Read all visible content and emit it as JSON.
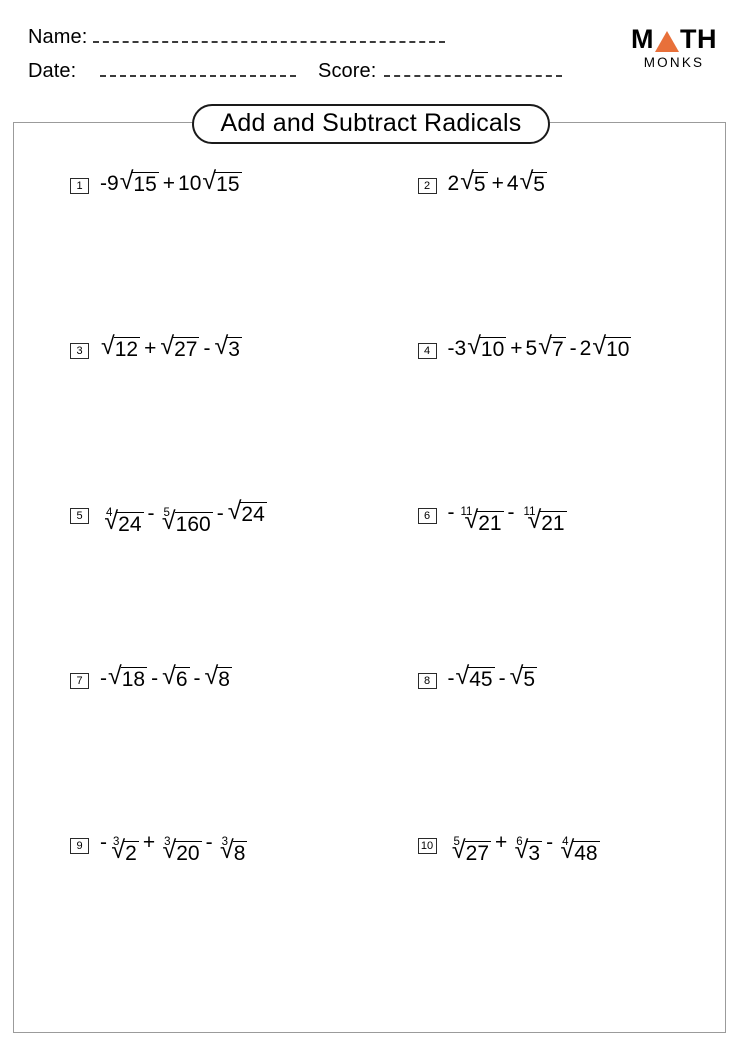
{
  "header": {
    "name_label": "Name:",
    "date_label": "Date:",
    "score_label": "Score:"
  },
  "logo": {
    "word_m": "M",
    "triangle_icon": "triangle-icon",
    "word_th": "TH",
    "subtitle": "MONKS",
    "accent_color": "#e8703a"
  },
  "worksheet": {
    "title": "Add and Subtract Radicals",
    "border_color": "#9b9b9b"
  },
  "problems": [
    {
      "number": "1",
      "expression": "-9√15 + 10√15",
      "terms": [
        {
          "coef": "-9",
          "index": "",
          "radicand": "15"
        },
        {
          "op": "+",
          "coef": "10",
          "index": "",
          "radicand": "15"
        }
      ]
    },
    {
      "number": "2",
      "expression": "2√5 + 4√5",
      "terms": [
        {
          "coef": "2",
          "index": "",
          "radicand": "5"
        },
        {
          "op": "+",
          "coef": "4",
          "index": "",
          "radicand": "5"
        }
      ]
    },
    {
      "number": "3",
      "expression": "√12 + √27 - √3",
      "terms": [
        {
          "coef": "",
          "index": "",
          "radicand": "12"
        },
        {
          "op": "+",
          "coef": "",
          "index": "",
          "radicand": "27"
        },
        {
          "op": "-",
          "coef": "",
          "index": "",
          "radicand": "3"
        }
      ]
    },
    {
      "number": "4",
      "expression": "-3√10 + 5√7 - 2√10",
      "terms": [
        {
          "coef": "-3",
          "index": "",
          "radicand": "10"
        },
        {
          "op": "+",
          "coef": "5",
          "index": "",
          "radicand": "7"
        },
        {
          "op": "-",
          "coef": "2",
          "index": "",
          "radicand": "10"
        }
      ]
    },
    {
      "number": "5",
      "expression": "⁴√24 - ⁵√160 - √24",
      "terms": [
        {
          "coef": "",
          "index": "4",
          "radicand": "24"
        },
        {
          "op": "-",
          "coef": "",
          "index": "5",
          "radicand": "160"
        },
        {
          "op": "-",
          "coef": "",
          "index": "",
          "radicand": "24"
        }
      ]
    },
    {
      "number": "6",
      "expression": "-¹¹√21 - ¹¹√21",
      "terms": [
        {
          "coef": "-",
          "index": "11",
          "radicand": "21"
        },
        {
          "op": "-",
          "coef": "",
          "index": "11",
          "radicand": "21"
        }
      ]
    },
    {
      "number": "7",
      "expression": "-√18 - √6 - √8",
      "terms": [
        {
          "coef": "-",
          "index": "",
          "radicand": "18"
        },
        {
          "op": "-",
          "coef": "",
          "index": "",
          "radicand": "6"
        },
        {
          "op": "-",
          "coef": "",
          "index": "",
          "radicand": "8"
        }
      ]
    },
    {
      "number": "8",
      "expression": "-√45 - √5",
      "terms": [
        {
          "coef": "-",
          "index": "",
          "radicand": "45"
        },
        {
          "op": "-",
          "coef": "",
          "index": "",
          "radicand": "5"
        }
      ]
    },
    {
      "number": "9",
      "expression": "-³√2 + ³√20 - ³√8",
      "terms": [
        {
          "coef": "-",
          "index": "3",
          "radicand": "2"
        },
        {
          "op": "+",
          "coef": "",
          "index": "3",
          "radicand": "20"
        },
        {
          "op": "-",
          "coef": "",
          "index": "3",
          "radicand": "8"
        }
      ]
    },
    {
      "number": "10",
      "expression": "⁵√27 + ⁶√3 - ⁴√48",
      "terms": [
        {
          "coef": "",
          "index": "5",
          "radicand": "27"
        },
        {
          "op": "+",
          "coef": "",
          "index": "6",
          "radicand": "3"
        },
        {
          "op": "-",
          "coef": "",
          "index": "4",
          "radicand": "48"
        }
      ]
    }
  ]
}
